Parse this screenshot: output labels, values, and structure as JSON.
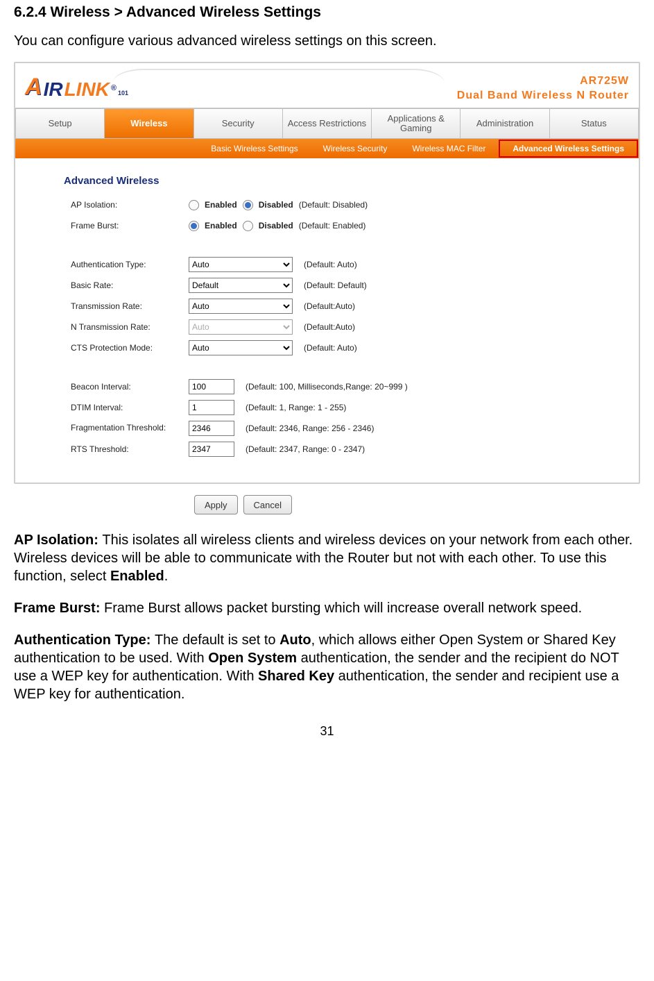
{
  "heading": "6.2.4 Wireless > Advanced Wireless Settings",
  "intro": "You can configure various advanced wireless settings on this screen.",
  "logo": {
    "text1": "A",
    "text2": "IR",
    "text3": "LINK",
    "text4": "101",
    "reg": "®"
  },
  "product": {
    "model": "AR725W",
    "tagline": "Dual Band Wireless N Router"
  },
  "tabs": [
    "Setup",
    "Wireless",
    "Security",
    "Access Restrictions",
    "Applications & Gaming",
    "Administration",
    "Status"
  ],
  "subtabs": [
    "Basic Wireless Settings",
    "Wireless Security",
    "Wireless MAC Filter",
    "Advanced Wireless Settings"
  ],
  "panel_title": "Advanced Wireless",
  "radios": {
    "ap_isolation": {
      "label": "AP Isolation:",
      "enabled": "Enabled",
      "disabled": "Disabled",
      "hint": "(Default: Disabled)"
    },
    "frame_burst": {
      "label": "Frame Burst:",
      "enabled": "Enabled",
      "disabled": "Disabled",
      "hint": "(Default: Enabled)"
    }
  },
  "selects": {
    "auth": {
      "label": "Authentication Type:",
      "value": "Auto",
      "hint": "(Default: Auto)"
    },
    "basic": {
      "label": "Basic Rate:",
      "value": "Default",
      "hint": "(Default: Default)"
    },
    "tx": {
      "label": "Transmission Rate:",
      "value": "Auto",
      "hint": "(Default:Auto)"
    },
    "ntx": {
      "label": "N Transmission Rate:",
      "value": "Auto",
      "hint": "(Default:Auto)"
    },
    "cts": {
      "label": "CTS Protection Mode:",
      "value": "Auto",
      "hint": "(Default: Auto)"
    }
  },
  "inputs": {
    "beacon": {
      "label": "Beacon Interval:",
      "value": "100",
      "hint": "(Default: 100, Milliseconds,Range: 20~999 )"
    },
    "dtim": {
      "label": "DTIM Interval:",
      "value": "1",
      "hint": "(Default: 1, Range: 1 - 255)"
    },
    "frag": {
      "label": "Fragmentation Threshold:",
      "value": "2346",
      "hint": "(Default: 2346, Range: 256 - 2346)"
    },
    "rts": {
      "label": "RTS Threshold:",
      "value": "2347",
      "hint": "(Default: 2347, Range: 0 - 2347)"
    }
  },
  "buttons": {
    "apply": "Apply",
    "cancel": "Cancel"
  },
  "post": {
    "p1a": "AP Isolation: ",
    "p1b": "This isolates all wireless clients and wireless devices on your network from each other. Wireless devices will be able to communicate with the Router but not with each other. To use this function, select ",
    "p1c": "Enabled",
    "p1d": ".",
    "p2a": "Frame Burst: ",
    "p2b": "Frame Burst allows packet bursting which will increase overall network speed.",
    "p3a": "Authentication Type: ",
    "p3b": "The default is set to ",
    "p3c": "Auto",
    "p3d": ", which allows either Open System or Shared Key authentication to be used. With ",
    "p3e": "Open System",
    "p3f": " authentication, the sender and the recipient do NOT use a WEP key for authentication. With ",
    "p3g": "Shared Key",
    "p3h": " authentication, the sender and recipient use a WEP key for authentication."
  },
  "page_number": "31"
}
